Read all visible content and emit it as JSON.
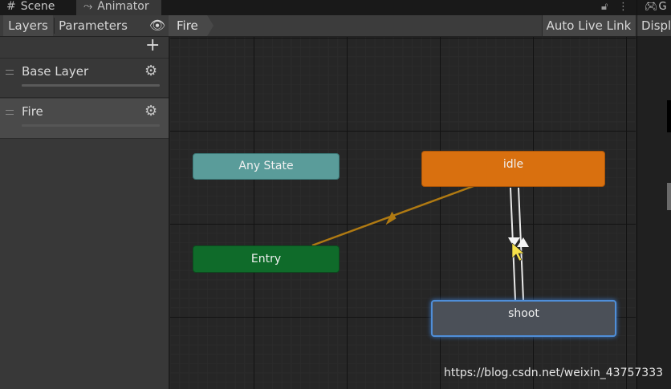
{
  "tabs": [
    {
      "label": "Scene",
      "icon": "grid-icon"
    },
    {
      "label": "Animator",
      "icon": "animator-icon"
    }
  ],
  "right_tab": {
    "label": "G",
    "icon": "gamepad-icon"
  },
  "right_toolbar": {
    "label": "Displ"
  },
  "toolbar": {
    "layers_label": "Layers",
    "parameters_label": "Parameters",
    "breadcrumb": "Fire",
    "auto_live_link_label": "Auto Live Link"
  },
  "layers": [
    {
      "name": "Base Layer"
    },
    {
      "name": "Fire"
    }
  ],
  "graph": {
    "states": {
      "any_state": "Any State",
      "entry": "Entry",
      "idle": "idle",
      "shoot": "shoot"
    }
  },
  "colors": {
    "any_state": "#5a9c9a",
    "entry": "#0f6b2a",
    "idle_default": "#d9700f",
    "shoot_selected_border": "#4f8ed8",
    "entry_transition": "#b07a12",
    "state_transition": "#e8e8e8"
  },
  "watermark": "https://blog.csdn.net/weixin_43757333"
}
